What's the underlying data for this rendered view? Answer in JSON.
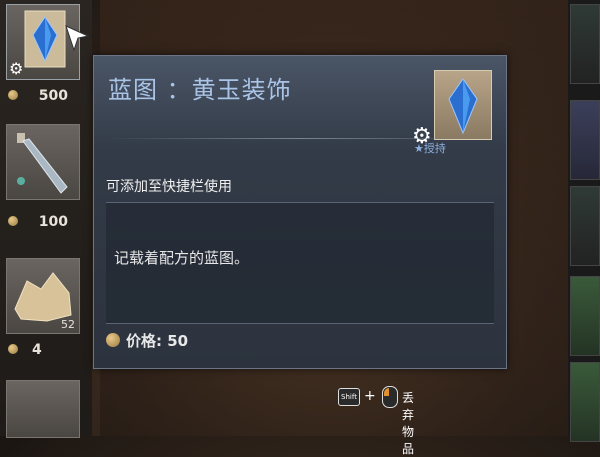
{
  "left_slots": [
    {
      "price": "500",
      "has_gear": true
    },
    {
      "price": "100"
    },
    {
      "price": "4",
      "qty": "52"
    }
  ],
  "tooltip": {
    "title": "蓝图 ：黄玉装饰",
    "sub_label": "★授持",
    "usage": "可添加至快捷栏使用",
    "description": "记载着配方的蓝图。",
    "price_label": "价格: 50"
  },
  "hint": {
    "key_label": "Shift",
    "action": "丢弃物品"
  },
  "colors": {
    "title": "#a9c4e6",
    "tooltip_bg": "#333b48",
    "coin": "#c8a86a"
  },
  "icons": [
    "gear-icon",
    "coin-icon",
    "blueprint-icon",
    "bottle-icon",
    "ore-icon",
    "cursor-icon",
    "mouse-icon"
  ]
}
